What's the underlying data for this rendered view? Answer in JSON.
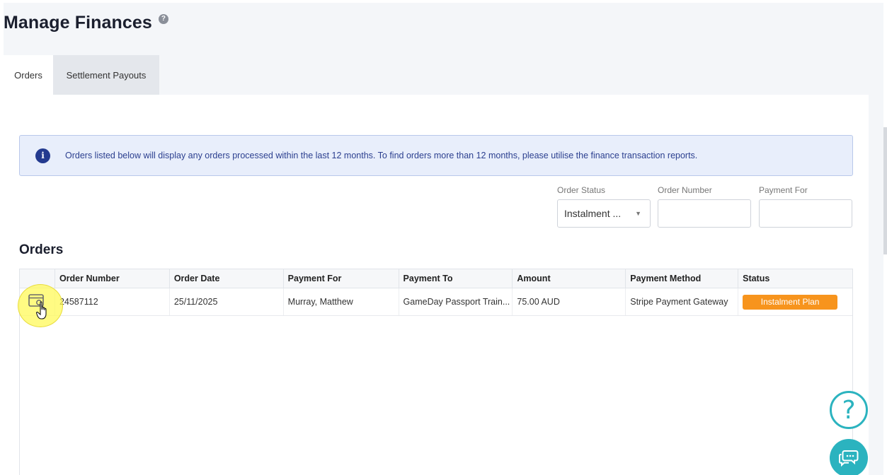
{
  "page": {
    "title": "Manage Finances",
    "help_glyph": "?"
  },
  "tabs": [
    {
      "label": "Orders",
      "active": true
    },
    {
      "label": "Settlement Payouts",
      "active": false
    }
  ],
  "info_banner": {
    "icon_glyph": "i",
    "text": "Orders listed below will display any orders processed within the last 12 months. To find orders more than 12 months, please utilise the finance transaction reports."
  },
  "filters": {
    "order_status": {
      "label": "Order Status",
      "value": "Instalment ...",
      "arrow": "▼"
    },
    "order_number": {
      "label": "Order Number",
      "value": ""
    },
    "payment_for": {
      "label": "Payment For",
      "value": ""
    }
  },
  "orders": {
    "section_title": "Orders",
    "columns": [
      "Order Number",
      "Order Date",
      "Payment For",
      "Payment To",
      "Amount",
      "Payment Method",
      "Status"
    ],
    "rows": [
      {
        "order_number": "24587112",
        "order_date": "25/11/2025",
        "payment_for": "Murray, Matthew",
        "payment_to": "GameDay Passport Train...",
        "amount": "75.00 AUD",
        "payment_method": "Stripe Payment Gateway",
        "status": "Instalment Plan"
      }
    ]
  },
  "floating": {
    "help_glyph": "?"
  },
  "colors": {
    "accent_teal": "#2bb3bf",
    "status_orange": "#f7941d",
    "info_bg": "#e8eefb",
    "info_icon": "#233a8f"
  }
}
